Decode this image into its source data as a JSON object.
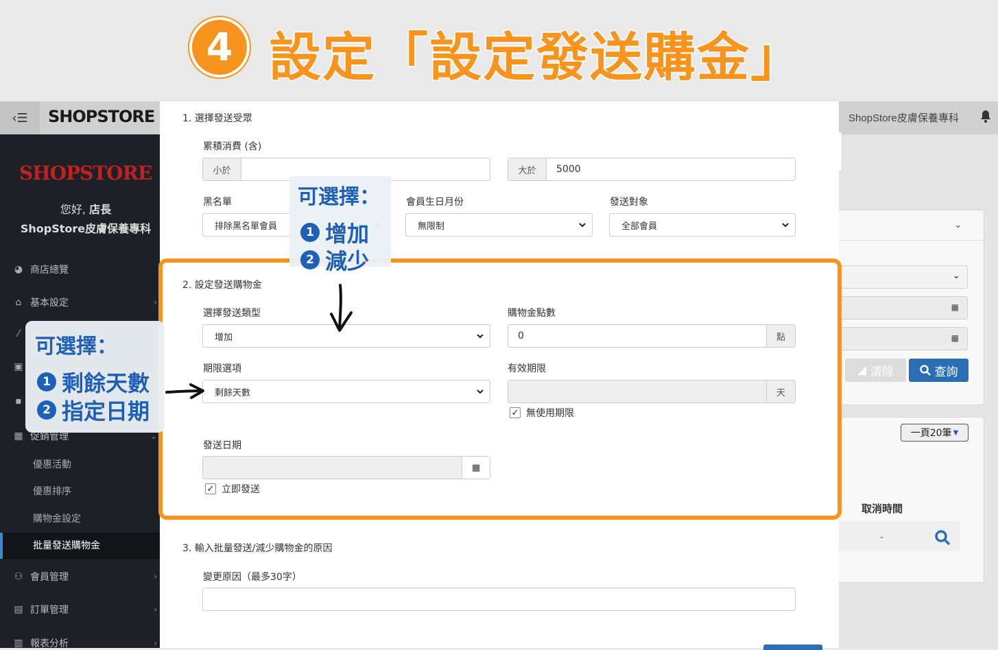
{
  "banner": {
    "step_number": "4",
    "title": "設定「設定發送購金」"
  },
  "topbar": {
    "toggle_label": "‹☰",
    "logo_text": "SHOPSTORE",
    "shop_name": "ShopStore皮膚保養專科"
  },
  "sidebar": {
    "logo_text": "SHOPSTORE",
    "greeting_prefix": "您好, ",
    "greeting_name": "店長",
    "shop_name": "ShopStore皮膚保養專科",
    "items": [
      {
        "label": "商店總覽",
        "icon": "dashboard-icon"
      },
      {
        "label": "基本設定",
        "icon": "bank-icon"
      },
      {
        "label": "",
        "icon": "magic-icon"
      },
      {
        "label": "",
        "icon": "lock-icon"
      },
      {
        "label": "",
        "icon": "cart-icon"
      },
      {
        "label": "促銷管理",
        "icon": "gift-icon"
      },
      {
        "label": "會員管理",
        "icon": "users-icon"
      },
      {
        "label": "訂單管理",
        "icon": "file-icon"
      },
      {
        "label": "報表分析",
        "icon": "chart-icon"
      }
    ],
    "sub_items": [
      "優惠活動",
      "優惠排序",
      "購物金設定",
      "批量發送購物金"
    ]
  },
  "background_page": {
    "clear_button": "清除",
    "query_button": "查詢",
    "per_page": "一頁20筆",
    "column_cancel_time": "取消時間",
    "cell_dash": "-"
  },
  "modal": {
    "section1": {
      "title": "1. 選擇發送受眾",
      "cumulative_label": "累積消費 (含)",
      "less_than_addon": "小於",
      "less_than_value": "",
      "greater_than_addon": "大於",
      "greater_than_value": "5000",
      "blacklist_label": "黑名單",
      "blacklist_value": "排除黑名單會員",
      "birthday_label": "會員生日月份",
      "birthday_value": "無限制",
      "target_label": "發送對象",
      "target_value": "全部會員"
    },
    "section2": {
      "title": "2. 設定發送購物金",
      "type_label": "選擇發送類型",
      "type_value": "增加",
      "points_label": "購物金點數",
      "points_value": "0",
      "points_unit": "點",
      "period_label": "期限選項",
      "period_value": "剩餘天數",
      "valid_label": "有效期限",
      "valid_value": "",
      "valid_unit": "天",
      "no_limit_label": "無使用期限",
      "send_date_label": "發送日期",
      "send_date_value": "",
      "send_now_label": "立即發送"
    },
    "section3": {
      "title": "3. 輸入批量發送/減少購物金的原因",
      "reason_label": "變更原因（最多30字）",
      "reason_value": ""
    }
  },
  "callouts": {
    "top": {
      "title": "可選擇：",
      "options": [
        {
          "num": "1",
          "text": "增加"
        },
        {
          "num": "2",
          "text": "減少"
        }
      ]
    },
    "left": {
      "title": "可選擇：",
      "options": [
        {
          "num": "1",
          "text": "剩餘天數"
        },
        {
          "num": "2",
          "text": "指定日期"
        }
      ]
    }
  },
  "colors": {
    "accent_orange": "#f7941d",
    "callout_blue": "#1e5fb8",
    "sidebar_bg": "#1d2127"
  }
}
